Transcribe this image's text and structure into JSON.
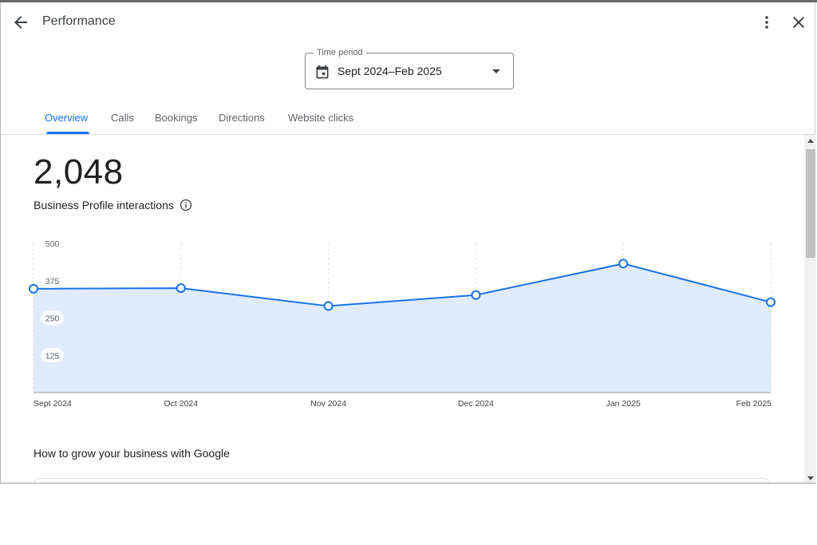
{
  "header": {
    "title": "Performance",
    "back_icon": "arrow-back-icon",
    "more_icon": "more-vert-icon",
    "close_icon": "close-icon"
  },
  "time_period": {
    "label": "Time period",
    "value": "Sept 2024–Feb 2025",
    "icon": "calendar-icon"
  },
  "tabs": [
    {
      "label": "Overview",
      "active": true
    },
    {
      "label": "Calls",
      "active": false
    },
    {
      "label": "Bookings",
      "active": false
    },
    {
      "label": "Directions",
      "active": false
    },
    {
      "label": "Website clicks",
      "active": false
    }
  ],
  "metric": {
    "value": "2,048",
    "label": "Business Profile interactions"
  },
  "chart_data": {
    "type": "area",
    "categories": [
      "Sept 2024",
      "Oct 2024",
      "Nov 2024",
      "Dec 2024",
      "Jan 2025",
      "Feb 2025"
    ],
    "values": [
      348,
      350,
      290,
      327,
      432,
      303
    ],
    "yticks": [
      125,
      250,
      375,
      500
    ],
    "ylim": [
      0,
      500
    ],
    "grid": "vertical-dashed",
    "line_color": "#1a73e8",
    "fill_color": "#e0ebfd"
  },
  "section": {
    "title": "How to grow your business with Google"
  },
  "colors": {
    "accent": "#1a73e8",
    "text": "#202124",
    "muted": "#5f6368"
  }
}
